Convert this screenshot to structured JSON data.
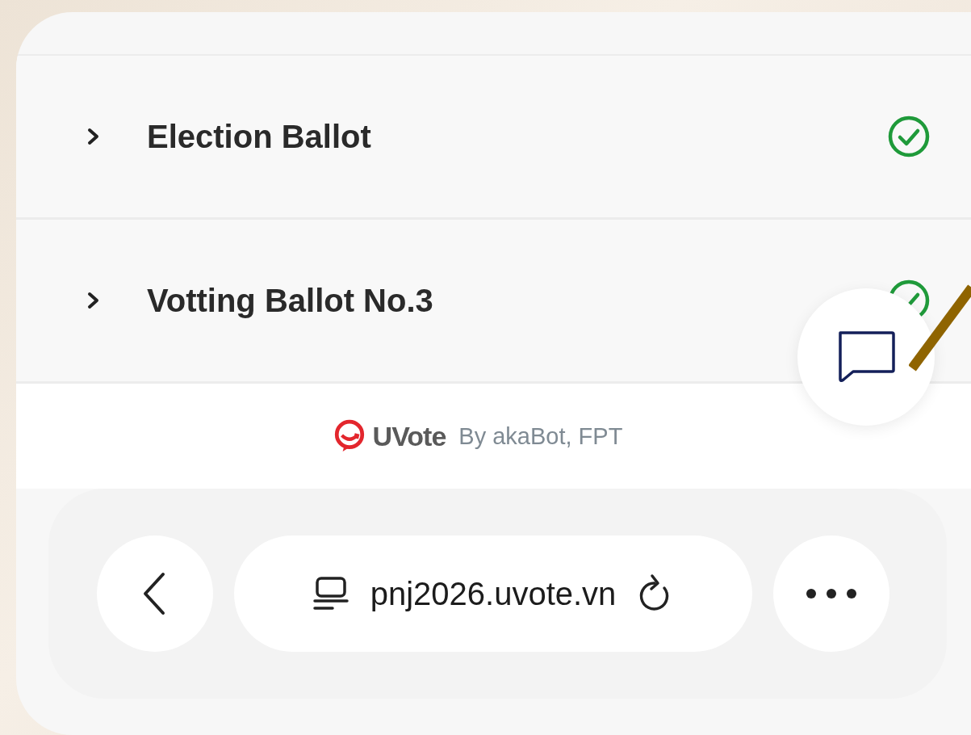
{
  "ballots": [
    {
      "title": "Election Ballot",
      "done": true
    },
    {
      "title": "Votting Ballot No.3",
      "done": true
    }
  ],
  "footer": {
    "brand": "UVote",
    "byline": "By akaBot, FPT"
  },
  "browser_bar": {
    "url": "pnj2026.uvote.vn"
  }
}
